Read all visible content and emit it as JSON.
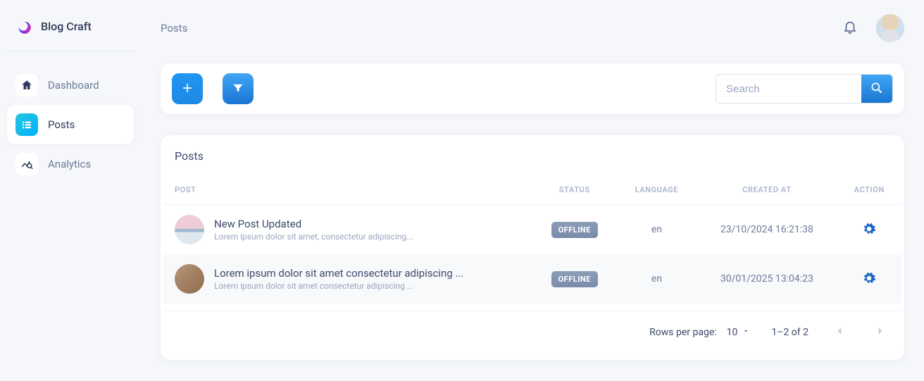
{
  "brand": {
    "name": "Blog Craft"
  },
  "sidebar": {
    "items": [
      {
        "label": "Dashboard"
      },
      {
        "label": "Posts"
      },
      {
        "label": "Analytics"
      }
    ]
  },
  "header": {
    "page_title": "Posts"
  },
  "toolbar": {
    "search": {
      "placeholder": "Search",
      "value": ""
    }
  },
  "table": {
    "title": "Posts",
    "columns": {
      "post": "POST",
      "status": "STATUS",
      "language": "LANGUAGE",
      "created": "CREATED AT",
      "action": "ACTION"
    },
    "rows": [
      {
        "title": "New Post Updated",
        "subtitle": "Lorem ipsum dolor sit amet, consectetur adipiscing...",
        "status": "OFFLINE",
        "language": "en",
        "created": "23/10/2024 16:21:38"
      },
      {
        "title": "Lorem ipsum dolor sit amet consectetur adipiscing ...",
        "subtitle": "Lorem ipsum dolor sit amet consectetur adipiscing ...",
        "status": "OFFLINE",
        "language": "en",
        "created": "30/01/2025 13:04:23"
      }
    ]
  },
  "pagination": {
    "rows_per_page_label": "Rows per page:",
    "rows_per_page_value": "10",
    "range": "1–2 of 2"
  }
}
